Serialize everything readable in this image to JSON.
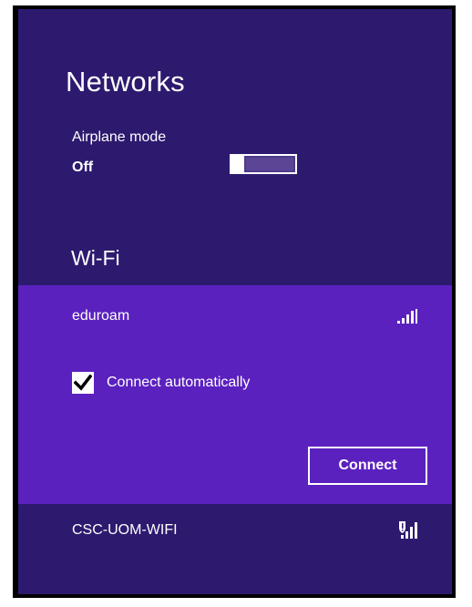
{
  "panel": {
    "title": "Networks",
    "background_color": "#2d1a6f",
    "accent_color": "#5b21bf"
  },
  "airplane_mode": {
    "label": "Airplane mode",
    "state": "Off"
  },
  "wifi": {
    "header": "Wi-Fi",
    "networks": [
      {
        "name": "eduroam",
        "signal_icon": "signal-strength-icon",
        "selected": true,
        "connect_automatically_label": "Connect automatically",
        "connect_automatically_checked": true,
        "connect_button_label": "Connect"
      },
      {
        "name": "CSC-UOM-WIFI",
        "signal_icon": "signal-strength-secured-icon",
        "selected": false
      }
    ]
  }
}
